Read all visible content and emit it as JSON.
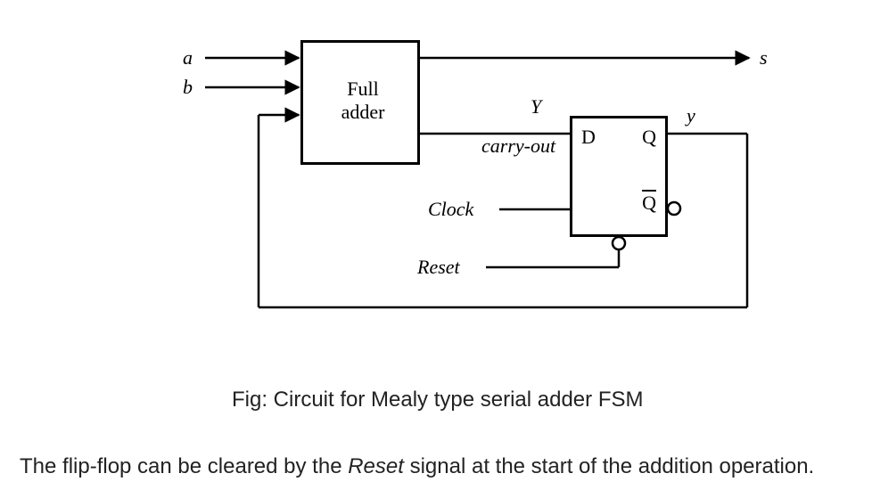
{
  "inputs": {
    "a": "a",
    "b": "b"
  },
  "blocks": {
    "full_adder": {
      "line1": "Full",
      "line2": "adder"
    },
    "flip_flop": {
      "D": "D",
      "Q": "Q",
      "Qbar": "Q"
    }
  },
  "signals": {
    "Y": "Y",
    "carry_out": "carry-out",
    "Clock": "Clock",
    "Reset": "Reset",
    "s": "s",
    "y": "y"
  },
  "caption": "Fig: Circuit for Mealy type serial adder FSM",
  "body_text_parts": {
    "p1": "The flip-flop can be cleared by the ",
    "reset_word": "Reset",
    "p2": " signal at the start of the addition operation."
  }
}
